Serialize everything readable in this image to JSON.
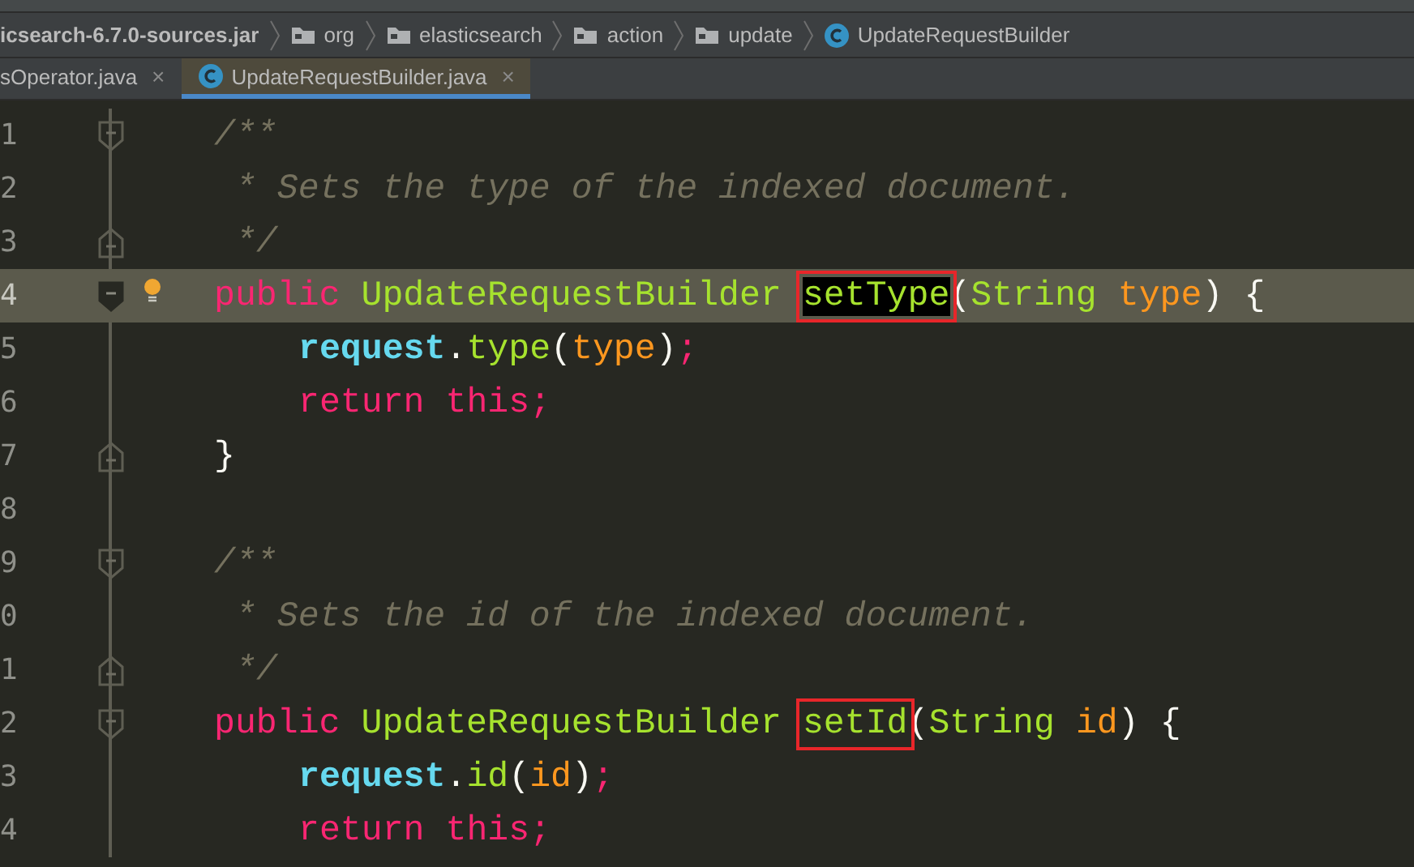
{
  "breadcrumbs": [
    {
      "label": "icsearch-6.7.0-sources.jar",
      "kind": "jar"
    },
    {
      "label": "org",
      "kind": "folder"
    },
    {
      "label": "elasticsearch",
      "kind": "folder"
    },
    {
      "label": "action",
      "kind": "folder"
    },
    {
      "label": "update",
      "kind": "folder"
    },
    {
      "label": "UpdateRequestBuilder",
      "kind": "class"
    }
  ],
  "tabs": [
    {
      "label": "sOperator.java",
      "selected": false,
      "kind": "plain",
      "close": "×"
    },
    {
      "label": "UpdateRequestBuilder.java",
      "selected": true,
      "kind": "class",
      "close": "×"
    }
  ],
  "editor": {
    "lines": [
      {
        "number": "1",
        "fold_start": true,
        "fold_end": false,
        "current": false,
        "indented": false,
        "tokens": [
          {
            "text": "/**",
            "kind": "comment"
          }
        ]
      },
      {
        "number": "2",
        "fold_start": false,
        "fold_end": false,
        "current": false,
        "indented": false,
        "tokens": [
          {
            "text": "* Sets the type of the indexed document.",
            "kind": "comment",
            "space_before": true
          }
        ]
      },
      {
        "number": "3",
        "fold_start": false,
        "fold_end": true,
        "current": false,
        "indented": false,
        "tokens": [
          {
            "text": "*/",
            "kind": "comment",
            "space_before": true
          }
        ]
      },
      {
        "number": "4",
        "fold_start": true,
        "fold_end": false,
        "current": true,
        "bulb": true,
        "indented": false,
        "tokens": [
          {
            "text": "public",
            "kind": "keyword"
          },
          {
            "text": "UpdateRequestBuilder",
            "kind": "type",
            "space_before": true
          },
          {
            "text": "setType",
            "kind": "method",
            "space_before": true,
            "boxed": true,
            "highlighted": true
          },
          {
            "text": "(",
            "kind": "plain"
          },
          {
            "text": "String",
            "kind": "type"
          },
          {
            "text": "type",
            "kind": "param",
            "space_before": true
          },
          {
            "text": ")",
            "kind": "plain"
          },
          {
            "text": "{",
            "kind": "plain",
            "space_before": true
          }
        ]
      },
      {
        "number": "5",
        "fold_start": false,
        "fold_end": false,
        "current": false,
        "indented": true,
        "tokens": [
          {
            "text": "request",
            "kind": "field"
          },
          {
            "text": ".",
            "kind": "plain"
          },
          {
            "text": "type",
            "kind": "method"
          },
          {
            "text": "(",
            "kind": "plain"
          },
          {
            "text": "type",
            "kind": "param"
          },
          {
            "text": ")",
            "kind": "plain"
          },
          {
            "text": ";",
            "kind": "keyword"
          }
        ]
      },
      {
        "number": "6",
        "fold_start": false,
        "fold_end": false,
        "current": false,
        "indented": true,
        "tokens": [
          {
            "text": "return",
            "kind": "keyword"
          },
          {
            "text": "this;",
            "kind": "keyword",
            "space_before": true
          }
        ]
      },
      {
        "number": "7",
        "fold_start": false,
        "fold_end": true,
        "current": false,
        "indented": false,
        "tokens": [
          {
            "text": "}",
            "kind": "plain"
          }
        ]
      },
      {
        "number": "8",
        "fold_start": false,
        "fold_end": false,
        "current": false,
        "indented": false
      },
      {
        "number": "9",
        "fold_start": true,
        "fold_end": false,
        "current": false,
        "indented": false,
        "tokens": [
          {
            "text": "/**",
            "kind": "comment"
          }
        ]
      },
      {
        "number": "0",
        "fold_start": false,
        "fold_end": false,
        "current": false,
        "indented": false,
        "tokens": [
          {
            "text": "* Sets the id of the indexed document.",
            "kind": "comment",
            "space_before": true
          }
        ]
      },
      {
        "number": "1",
        "fold_start": false,
        "fold_end": true,
        "current": false,
        "indented": false,
        "tokens": [
          {
            "text": "*/",
            "kind": "comment",
            "space_before": true
          }
        ]
      },
      {
        "number": "2",
        "fold_start": true,
        "fold_end": false,
        "current": false,
        "indented": false,
        "tokens": [
          {
            "text": "public",
            "kind": "keyword"
          },
          {
            "text": "UpdateRequestBuilder",
            "kind": "type",
            "space_before": true
          },
          {
            "text": "setId",
            "kind": "method",
            "space_before": true,
            "boxed": true,
            "highlighted": false
          },
          {
            "text": "(",
            "kind": "plain"
          },
          {
            "text": "String",
            "kind": "type"
          },
          {
            "text": "id",
            "kind": "param",
            "space_before": true
          },
          {
            "text": ")",
            "kind": "plain"
          },
          {
            "text": "{",
            "kind": "plain",
            "space_before": true
          }
        ]
      },
      {
        "number": "3",
        "fold_start": false,
        "fold_end": false,
        "current": false,
        "indented": true,
        "tokens": [
          {
            "text": "request",
            "kind": "field"
          },
          {
            "text": ".",
            "kind": "plain"
          },
          {
            "text": "id",
            "kind": "method"
          },
          {
            "text": "(",
            "kind": "plain"
          },
          {
            "text": "id",
            "kind": "param"
          },
          {
            "text": ")",
            "kind": "plain"
          },
          {
            "text": ";",
            "kind": "keyword"
          }
        ]
      },
      {
        "number": "4",
        "fold_start": false,
        "fold_end": false,
        "current": false,
        "indented": true,
        "tokens": [
          {
            "text": "return",
            "kind": "keyword"
          },
          {
            "text": "this;",
            "kind": "keyword",
            "space_before": true
          }
        ]
      }
    ]
  }
}
